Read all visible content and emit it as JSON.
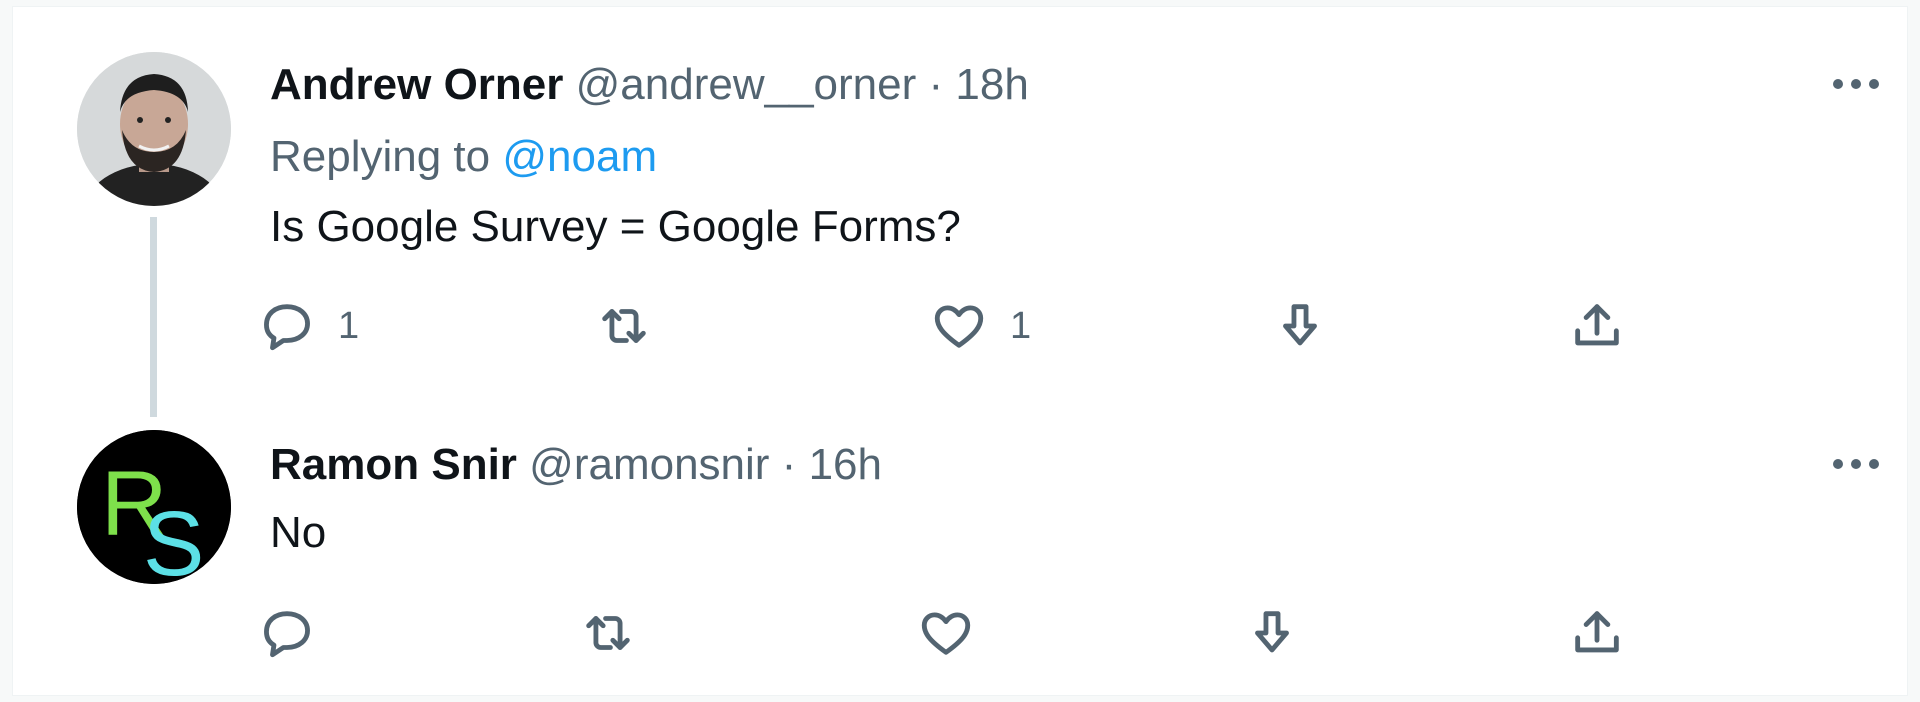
{
  "tweets": [
    {
      "author_name": "Andrew Orner",
      "handle": "@andrew__orner",
      "separator": "·",
      "time": "18h",
      "replying_prefix": "Replying to",
      "replying_to": "@noam",
      "text": "Is Google Survey = Google Forms?",
      "reply_count": "1",
      "like_count": "1",
      "avatar": "portrait-photo"
    },
    {
      "author_name": "Ramon Snir",
      "handle": "@ramonsnir",
      "separator": "·",
      "time": "16h",
      "text": "No",
      "avatar_letters": [
        "R",
        "S"
      ]
    }
  ],
  "icons": [
    "reply-icon",
    "retweet-icon",
    "like-icon",
    "download-icon",
    "share-icon",
    "more-icon"
  ],
  "colors": {
    "mention": "#1d9bf0",
    "secondary_text": "#536471",
    "primary_text": "#0f1419",
    "thread_line": "#cfd9de",
    "avatar_r": "#7ee04b",
    "avatar_s": "#5ce0e6"
  }
}
